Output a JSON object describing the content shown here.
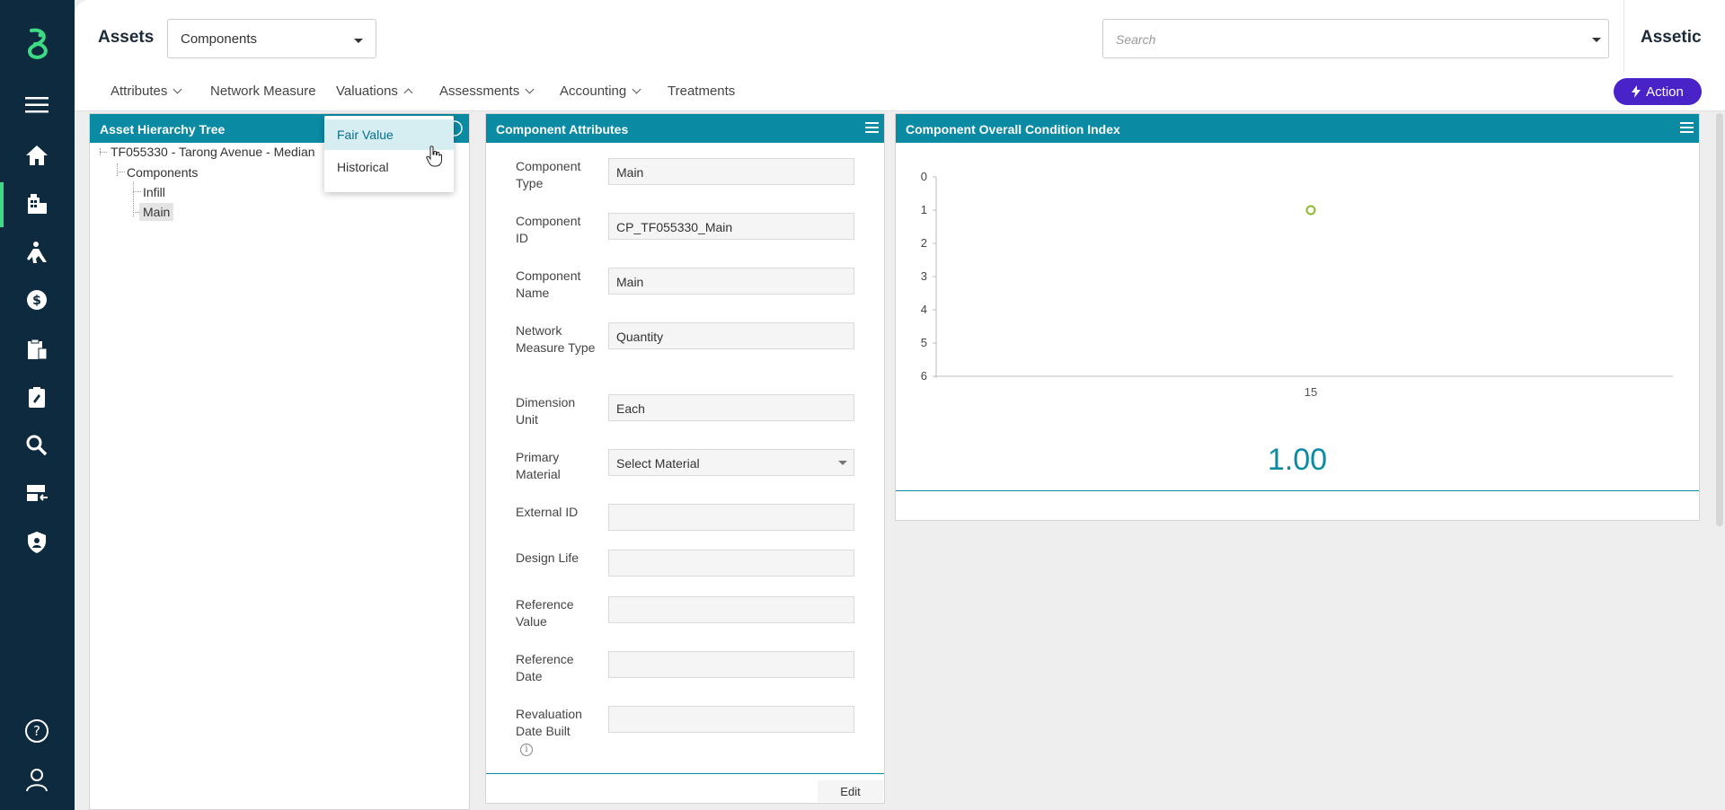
{
  "header": {
    "title": "Assets",
    "module_select": "Components",
    "search_placeholder": "Search",
    "brand": "Assetic"
  },
  "subnav": {
    "items": [
      "Attributes",
      "Network Measure",
      "Valuations",
      "Assessments",
      "Accounting",
      "Treatments"
    ],
    "action_label": "Action"
  },
  "valuations_menu": {
    "items": [
      "Fair Value",
      "Historical"
    ],
    "active": "Fair Value"
  },
  "hierarchy": {
    "title": "Asset Hierarchy Tree",
    "root": "TF055330 - Tarong Avenue - Median",
    "group": "Components",
    "children": [
      "Infill",
      "Main"
    ],
    "selected": "Main"
  },
  "attributes": {
    "title": "Component Attributes",
    "fields": [
      {
        "label": "Component Type",
        "value": "Main"
      },
      {
        "label": "Component ID",
        "value": "CP_TF055330_Main"
      },
      {
        "label": "Component Name",
        "value": "Main"
      },
      {
        "label": "Network Measure Type",
        "value": "Quantity"
      },
      {
        "label": "Dimension Unit",
        "value": "Each"
      },
      {
        "label": "Primary Material",
        "value": "Select Material"
      },
      {
        "label": "External ID",
        "value": ""
      },
      {
        "label": "Design Life",
        "value": ""
      },
      {
        "label": "Reference Value",
        "value": ""
      },
      {
        "label": "Reference Date",
        "value": ""
      },
      {
        "label": "Revaluation Date Built",
        "value": ""
      }
    ],
    "edit_label": "Edit"
  },
  "condition": {
    "title": "Component Overall Condition Index",
    "value_display": "1.00"
  },
  "chart_data": {
    "type": "scatter",
    "title": "",
    "xlabel": "",
    "ylabel": "",
    "x": [
      "15"
    ],
    "y": [
      1
    ],
    "ylim": [
      0,
      6
    ],
    "y_inverted": true,
    "yticks": [
      "0",
      "1",
      "2",
      "3",
      "4",
      "5",
      "6"
    ],
    "marker_color": "#8db92e",
    "grid": false
  },
  "colors": {
    "nav_bg": "#0d2a3f",
    "panel_header": "#0b8aa4",
    "action_button": "#4a23c8",
    "accent_green": "#3ddc84"
  }
}
